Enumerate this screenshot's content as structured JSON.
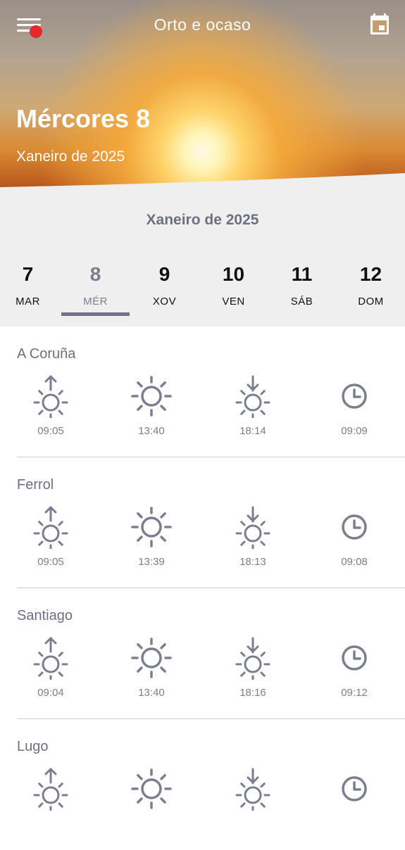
{
  "header": {
    "title": "Orto e ocaso",
    "day_title": "Mércores 8",
    "month_title": "Xaneiro de 2025",
    "menu_icon": "menu-icon",
    "calendar_icon": "calendar-icon",
    "notification_color": "#e8262d"
  },
  "date_strip": {
    "month_label": "Xaneiro de 2025",
    "days": [
      {
        "num": "7",
        "name": "MAR"
      },
      {
        "num": "8",
        "name": "MÉR"
      },
      {
        "num": "9",
        "name": "XOV"
      },
      {
        "num": "10",
        "name": "VEN"
      },
      {
        "num": "11",
        "name": "SÁB"
      },
      {
        "num": "12",
        "name": "DOM"
      }
    ],
    "selected_index": 1
  },
  "locations": [
    {
      "name": "A Coruña",
      "sunrise": "09:05",
      "noon": "13:40",
      "sunset": "18:14",
      "daylight": "09:09"
    },
    {
      "name": "Ferrol",
      "sunrise": "09:05",
      "noon": "13:39",
      "sunset": "18:13",
      "daylight": "09:08"
    },
    {
      "name": "Santiago",
      "sunrise": "09:04",
      "noon": "13:40",
      "sunset": "18:16",
      "daylight": "09:12"
    },
    {
      "name": "Lugo",
      "sunrise": "",
      "noon": "",
      "sunset": "",
      "daylight": ""
    }
  ],
  "icons": {
    "sunrise": "sunrise-icon",
    "noon": "sun-icon",
    "sunset": "sunset-icon",
    "daylight": "clock-icon"
  },
  "colors": {
    "accent": "#6f7282",
    "icon": "#7b7e8c"
  }
}
